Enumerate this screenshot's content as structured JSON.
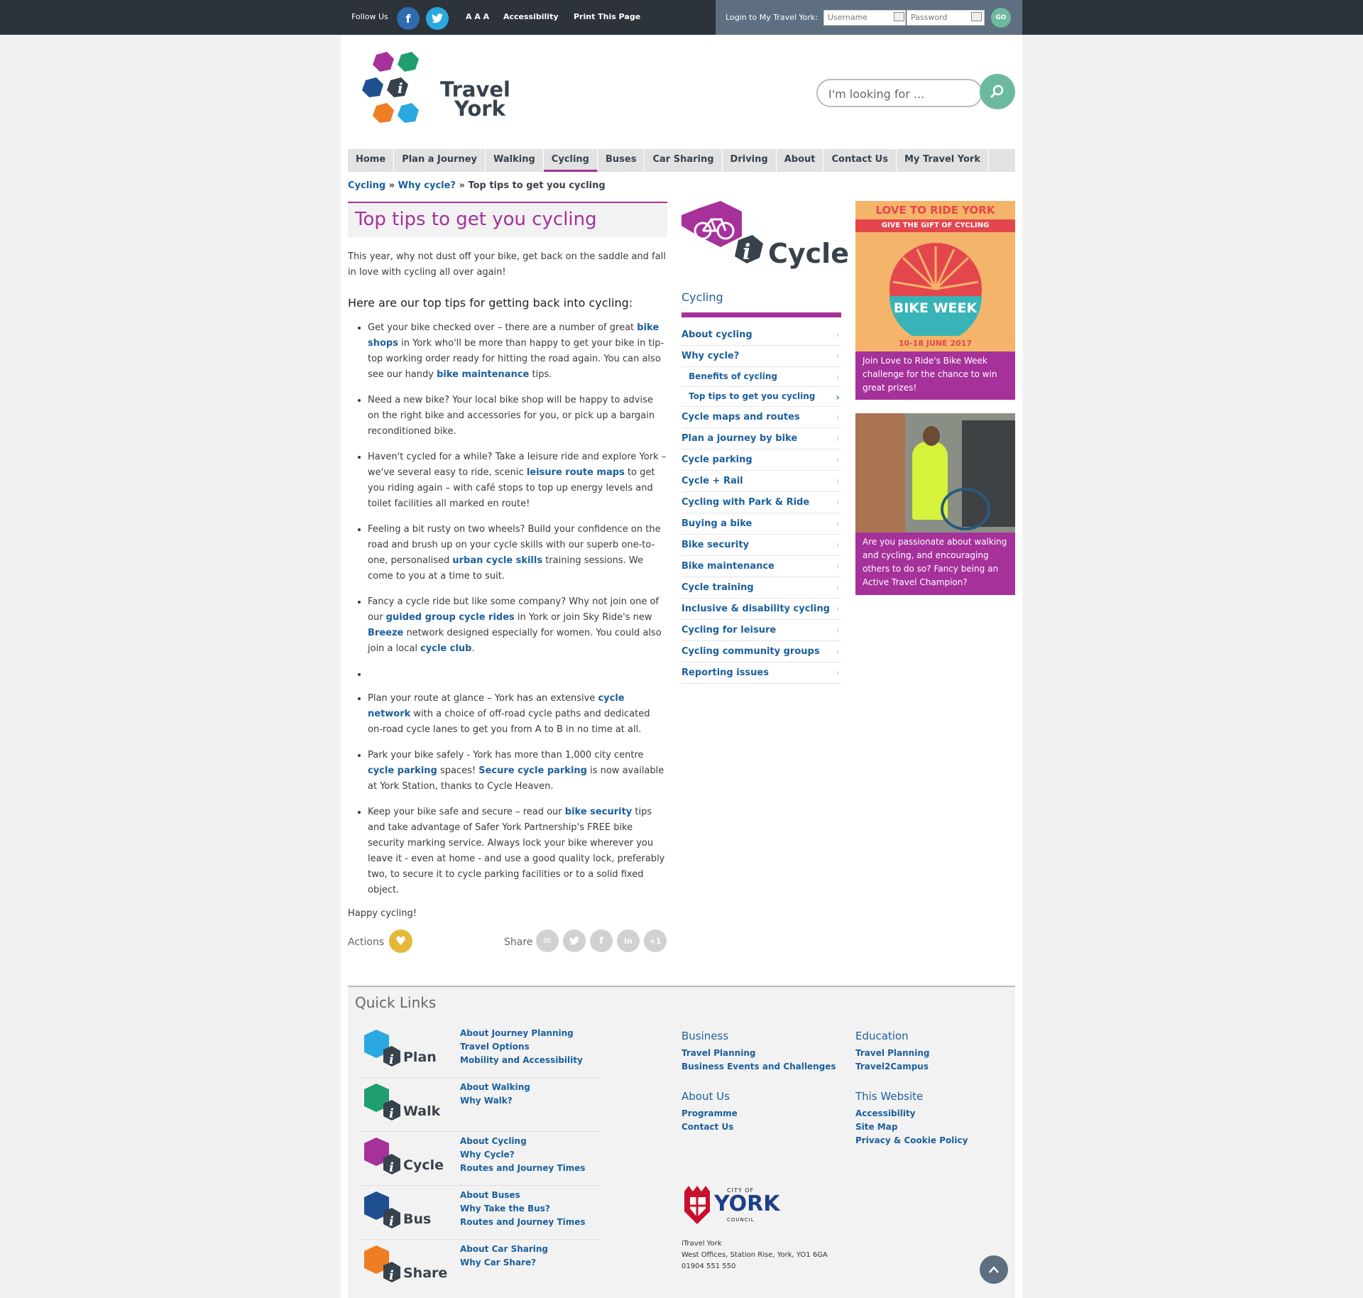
{
  "topbar": {
    "follow_label": "Follow Us",
    "facebook_glyph": "f",
    "twitter_glyph": "t",
    "text_size_label": "A A A",
    "accessibility_label": "Accessibility",
    "print_label": "Print This Page",
    "login_label": "Login to My Travel York:",
    "username_placeholder": "Username",
    "password_placeholder": "Password",
    "go_label": "GO"
  },
  "header": {
    "logo_line1": "Travel",
    "logo_line2": "York",
    "search_placeholder": "I'm looking for ..."
  },
  "nav": {
    "items": [
      "Home",
      "Plan a Journey",
      "Walking",
      "Cycling",
      "Buses",
      "Car Sharing",
      "Driving",
      "About",
      "Contact Us",
      "My Travel York"
    ],
    "active": "Cycling"
  },
  "breadcrumb": {
    "part1": "Cycling",
    "sep1": "»",
    "part2": "Why cycle?",
    "sep2": "»",
    "current": "Top tips to get you cycling"
  },
  "article": {
    "title": "Top tips to get you cycling",
    "intro": "This year, why not dust off your bike, get back on the saddle and fall in love with cycling all over again!",
    "subheading": "Here are our top tips for getting back into cycling:",
    "tip1": {
      "a": "Get your bike checked over – there are a number of great ",
      "l1": "bike shops",
      "b": " in York who'll be more than happy to get your bike in tip-top working order ready for hitting the road again. You can also see our handy ",
      "l2": "bike maintenance",
      "c": " tips."
    },
    "tip2": "Need a new bike? Your local bike shop will be happy to advise on the right bike and accessories for you, or pick up a bargain reconditioned bike.",
    "tip3": {
      "a": "Haven't cycled for a while? Take a leisure ride and explore York – we've several easy to ride, scenic ",
      "l1": "leisure route maps",
      "b": " to get you riding again – with café stops to top up energy levels and toilet facilities all marked en route!"
    },
    "tip4": {
      "a": "Feeling a bit rusty on two wheels? Build your confidence on the road and brush up on your cycle skills with our superb one-to-one, personalised ",
      "l1": "urban cycle skills",
      "b": " training sessions. We come to you at a time to suit."
    },
    "tip5": {
      "a": "Fancy a cycle ride but like some company? Why not join one of our ",
      "l1": "guided group cycle rides",
      "b": " in York or join Sky Ride's new ",
      "l2": "Breeze",
      "c": " network designed especially for women. You could also join a local ",
      "l3": "cycle club",
      "d": "."
    },
    "tip6": {
      "a": "Plan your route at glance – York has an extensive ",
      "l1": "cycle network",
      "b": " with a choice of off-road cycle paths and dedicated on-road cycle lanes to get you from A to B in no time at all."
    },
    "tip7": {
      "a": "Park your bike safely - York has more than 1,000 city centre ",
      "l1": "cycle parking",
      "b": " spaces! ",
      "l2": "Secure cycle parking",
      "c": " is now available at York Station, thanks to Cycle Heaven."
    },
    "tip8": {
      "a": "Keep your bike safe and secure – read our ",
      "l1": "bike security",
      "b": " tips and take advantage of Safer York Partnership's FREE bike security marking service. Always lock your bike wherever you leave it - even at home - and use a good quality lock, preferably two, to secure it to cycle parking facilities or to a solid fixed object."
    },
    "closing": "Happy cycling!",
    "actions_label": "Actions",
    "share_label": "Share",
    "plus_one": "+1"
  },
  "side_nav": {
    "logo_text": "Cycle",
    "title": "Cycling",
    "items": [
      {
        "label": "About cycling",
        "sub": false
      },
      {
        "label": "Why cycle?",
        "sub": false
      },
      {
        "label": "Benefits of cycling",
        "sub": true
      },
      {
        "label": "Top tips to get you cycling",
        "sub": true,
        "current": true
      },
      {
        "label": "Cycle maps and routes",
        "sub": false
      },
      {
        "label": "Plan a journey by bike",
        "sub": false
      },
      {
        "label": "Cycle parking",
        "sub": false
      },
      {
        "label": "Cycle + Rail",
        "sub": false
      },
      {
        "label": "Cycling with Park & Ride",
        "sub": false
      },
      {
        "label": "Buying a bike",
        "sub": false
      },
      {
        "label": "Bike security",
        "sub": false
      },
      {
        "label": "Bike maintenance",
        "sub": false
      },
      {
        "label": "Cycle training",
        "sub": false
      },
      {
        "label": "Inclusive & disability cycling",
        "sub": false
      },
      {
        "label": "Cycling for leisure",
        "sub": false
      },
      {
        "label": "Cycling community groups",
        "sub": false
      },
      {
        "label": "Reporting issues",
        "sub": false
      }
    ]
  },
  "promos": {
    "promo1": {
      "banner_title": "LOVE TO RIDE YORK",
      "banner_sub": "GIVE THE GIFT OF CYCLING",
      "banner_event": "BIKE WEEK",
      "banner_dates": "10-18 JUNE 2017",
      "text": "Join Love to Ride's Bike Week challenge for the chance to win great prizes!"
    },
    "promo2": {
      "text": "Are you passionate about walking and cycling, and encouraging others to do so? Fancy being an Active Travel Champion?"
    }
  },
  "footer": {
    "quick_links_title": "Quick Links",
    "groups": [
      {
        "logo": "Plan",
        "color": "#2aa9e0",
        "links": [
          "About Journey Planning",
          "Travel Options",
          "Mobility and Accessibility"
        ]
      },
      {
        "logo": "Walk",
        "color": "#1f9e6e",
        "links": [
          "About Walking",
          "Why Walk?"
        ]
      },
      {
        "logo": "Cycle",
        "color": "#a6319a",
        "links": [
          "About Cycling",
          "Why Cycle?",
          "Routes and Journey Times"
        ]
      },
      {
        "logo": "Bus",
        "color": "#1d4f91",
        "links": [
          "About Buses",
          "Why Take the Bus?",
          "Routes and Journey Times"
        ]
      },
      {
        "logo": "Share",
        "color": "#ef7d22",
        "links": [
          "About Car Sharing",
          "Why Car Share?"
        ]
      }
    ],
    "business": {
      "title": "Business",
      "links": [
        "Travel Planning",
        "Business Events and Challenges"
      ]
    },
    "education": {
      "title": "Education",
      "links": [
        "Travel Planning",
        "Travel2Campus"
      ]
    },
    "about": {
      "title": "About Us",
      "links": [
        "Programme",
        "Contact Us"
      ]
    },
    "website": {
      "title": "This Website",
      "links": [
        "Accessibility",
        "Site Map",
        "Privacy & Cookie Policy"
      ]
    },
    "council_small": "CITY OF",
    "council_name": "YORK",
    "council_sub": "COUNCIL",
    "address_line1": "iTravel York",
    "address_line2": "West Offices, Station Rise, York, YO1 6GA",
    "address_line3": "01904 551 550",
    "to_top_glyph": "^"
  },
  "colors": {
    "topbar": "#2c3339",
    "accent": "#a6319a",
    "link": "#1b5f9c",
    "search_button": "#6cba9d"
  }
}
